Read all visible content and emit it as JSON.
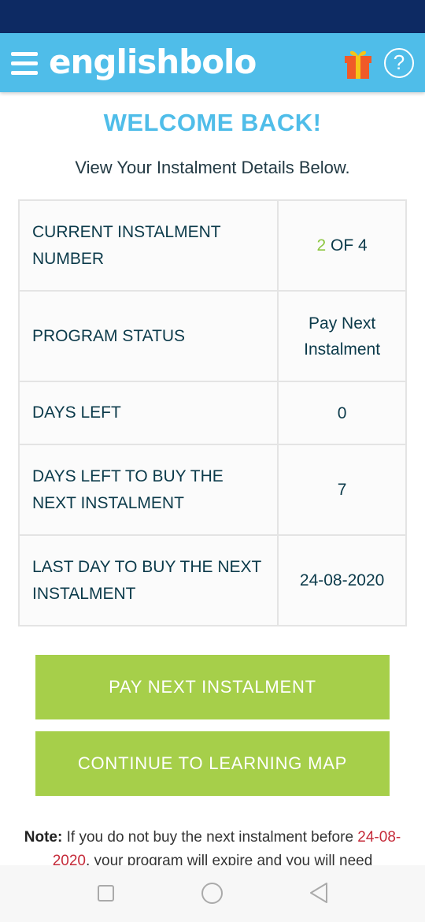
{
  "header": {
    "logo": "englishbolo",
    "menu_icon": "hamburger-menu-icon",
    "gift_icon": "gift-icon",
    "help_icon": "help-icon",
    "help_glyph": "?",
    "color": "#4fbde9"
  },
  "main": {
    "welcome": "WELCOME BACK!",
    "subtitle": "View Your Instalment Details Below."
  },
  "table": {
    "rows": [
      {
        "label": "CURRENT INSTALMENT NUMBER",
        "value_current": "2",
        "value_rest": " OF 4"
      },
      {
        "label": "PROGRAM STATUS",
        "value": "Pay Next Instalment"
      },
      {
        "label": "DAYS LEFT",
        "value": "0"
      },
      {
        "label": "DAYS LEFT TO BUY THE NEXT INSTALMENT",
        "value": "7"
      },
      {
        "label": "LAST DAY TO BUY THE NEXT INSTALMENT",
        "value": "24-08-2020"
      }
    ]
  },
  "buttons": {
    "pay": "PAY NEXT INSTALMENT",
    "continue": "CONTINUE TO LEARNING MAP",
    "color": "#a6cf4a"
  },
  "note": {
    "label": "Note:",
    "text_before": " If you do not buy the next instalment before ",
    "date": "24-08-2020",
    "text_after": ", your program will expire and you will need"
  },
  "nav": {
    "recent_icon": "square-recent-apps-icon",
    "home_icon": "circle-home-icon",
    "back_icon": "triangle-back-icon"
  },
  "colors": {
    "status_bar": "#0d2a63",
    "accent_red": "#c52b3a",
    "accent_green": "#8cc63f"
  }
}
